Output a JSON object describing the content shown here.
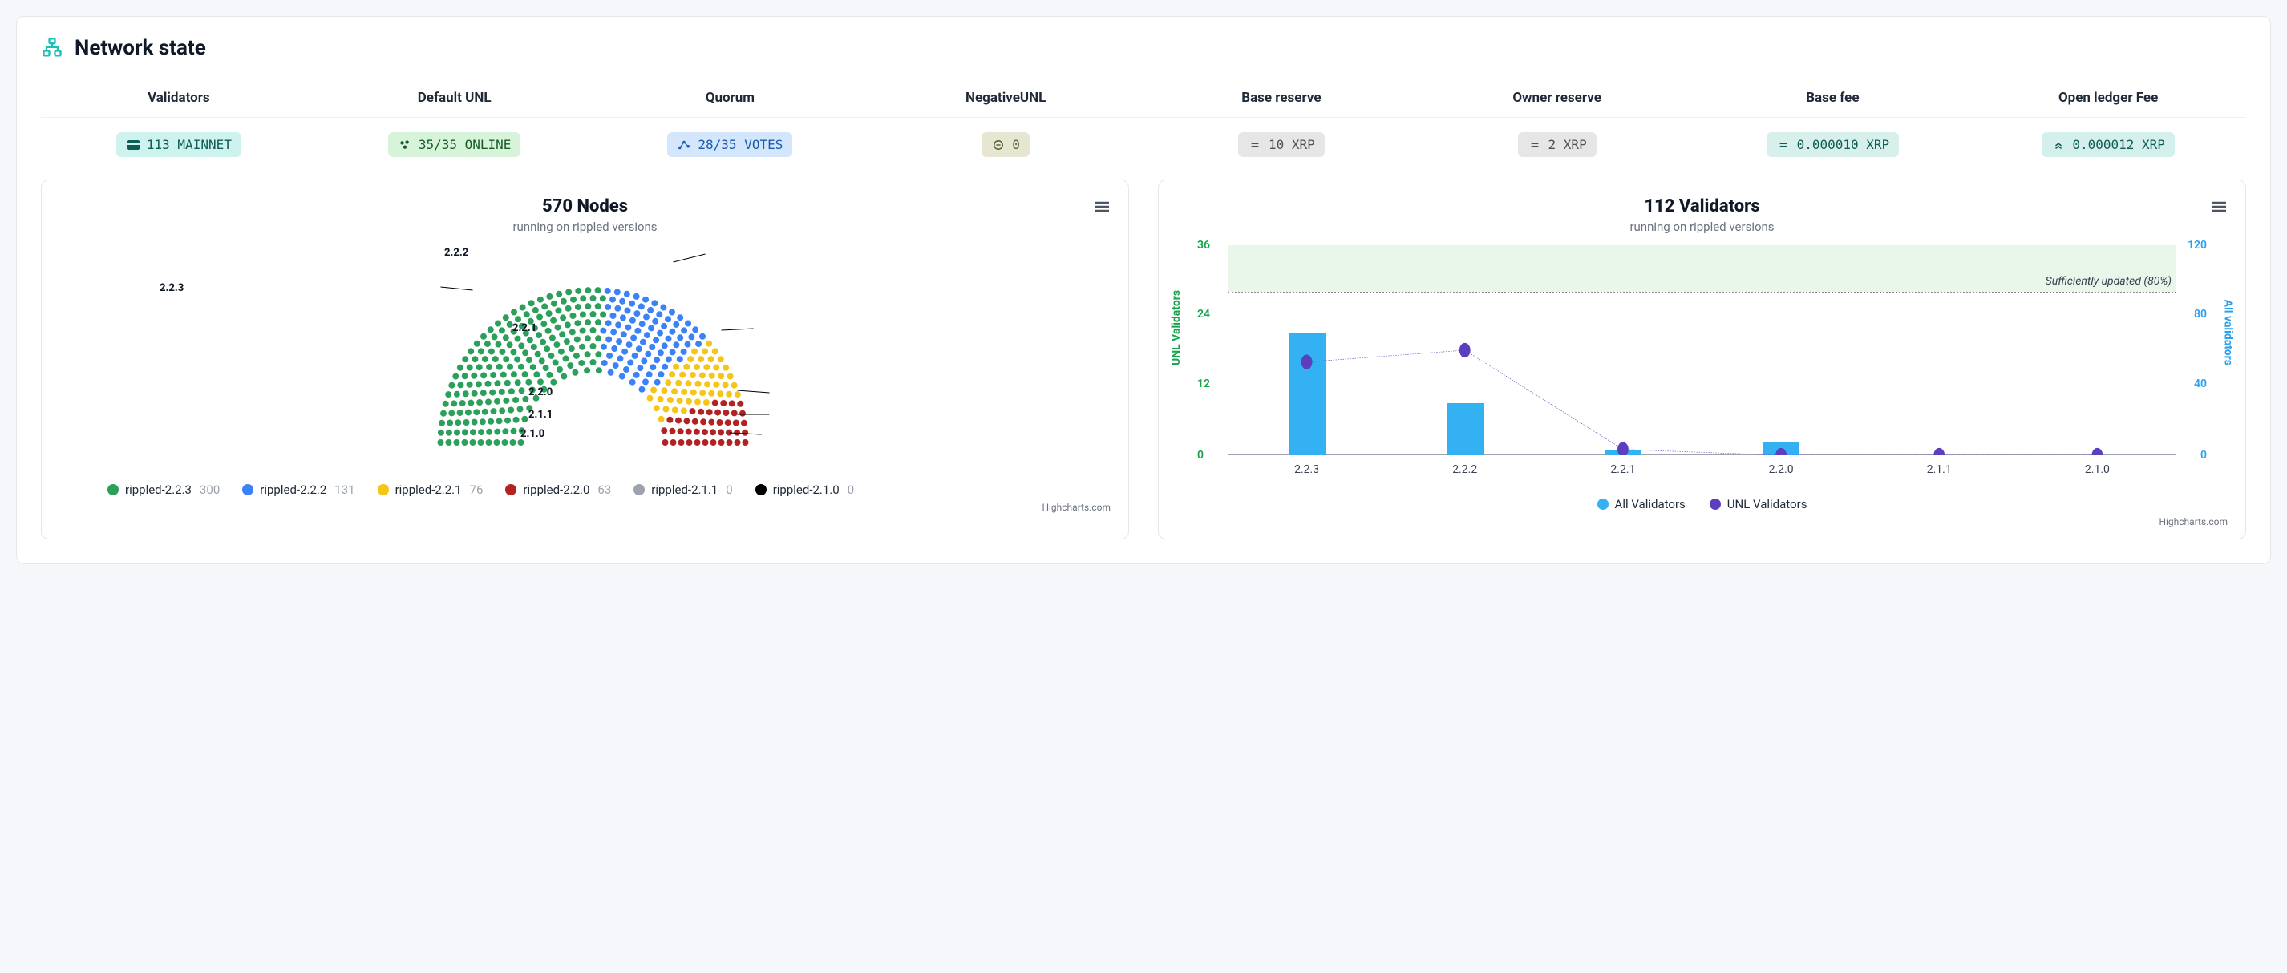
{
  "header": {
    "title": "Network state"
  },
  "stats": {
    "cols": [
      {
        "label": "Validators",
        "badge": "113 MAINNET",
        "class": "b-teal"
      },
      {
        "label": "Default UNL",
        "badge": "35/35 ONLINE",
        "class": "b-green"
      },
      {
        "label": "Quorum",
        "badge": "28/35 VOTES",
        "class": "b-blue"
      },
      {
        "label": "NegativeUNL",
        "badge": "0",
        "class": "b-olive"
      },
      {
        "label": "Base reserve",
        "badge": "10 XRP",
        "class": "b-gray"
      },
      {
        "label": "Owner reserve",
        "badge": "2 XRP",
        "class": "b-gray"
      },
      {
        "label": "Base fee",
        "badge": "0.000010 XRP",
        "class": "b-mint"
      },
      {
        "label": "Open ledger Fee",
        "badge": "0.000012 XRP",
        "class": "b-teal2"
      }
    ]
  },
  "nodes_chart": {
    "title": "570 Nodes",
    "subtitle": "running on rippled versions",
    "credits": "Highcharts.com",
    "labels": [
      "2.2.3",
      "2.2.2",
      "2.2.1",
      "2.2.0",
      "2.1.1",
      "2.1.0"
    ],
    "legend": [
      {
        "name": "rippled-2.2.3",
        "count": "300",
        "color": "#2aa05a"
      },
      {
        "name": "rippled-2.2.2",
        "count": "131",
        "color": "#3b82f6"
      },
      {
        "name": "rippled-2.2.1",
        "count": "76",
        "color": "#f5c518"
      },
      {
        "name": "rippled-2.2.0",
        "count": "63",
        "color": "#b22222"
      },
      {
        "name": "rippled-2.1.1",
        "count": "0",
        "color": "#9ca3af"
      },
      {
        "name": "rippled-2.1.0",
        "count": "0",
        "color": "#000000"
      }
    ]
  },
  "validators_chart": {
    "title": "112 Validators",
    "subtitle": "running on rippled versions",
    "credits": "Highcharts.com",
    "y_left_label": "UNL Validators",
    "y_right_label": "All validators",
    "band_text": "Sufficiently updated (80%)",
    "y_left_ticks": [
      "36",
      "24",
      "12",
      "0"
    ],
    "y_right_ticks": [
      "120",
      "80",
      "40",
      "0"
    ],
    "categories": [
      "2.2.3",
      "2.2.2",
      "2.2.1",
      "2.2.0",
      "2.1.1",
      "2.1.0"
    ],
    "legend": {
      "bars": "All Validators",
      "line": "UNL Validators"
    }
  },
  "chart_data": [
    {
      "type": "pie",
      "title": "570 Nodes",
      "subtitle": "running on rippled versions",
      "series": [
        {
          "name": "rippled-2.2.3",
          "value": 300
        },
        {
          "name": "rippled-2.2.2",
          "value": 131
        },
        {
          "name": "rippled-2.2.1",
          "value": 76
        },
        {
          "name": "rippled-2.2.0",
          "value": 63
        },
        {
          "name": "rippled-2.1.1",
          "value": 0
        },
        {
          "name": "rippled-2.1.0",
          "value": 0
        }
      ]
    },
    {
      "type": "bar",
      "title": "112 Validators",
      "subtitle": "running on rippled versions",
      "categories": [
        "2.2.3",
        "2.2.2",
        "2.2.1",
        "2.2.0",
        "2.1.1",
        "2.1.0"
      ],
      "series": [
        {
          "name": "All Validators",
          "axis": "right",
          "type": "bar",
          "values": [
            70,
            30,
            3,
            8,
            0,
            0
          ]
        },
        {
          "name": "UNL Validators",
          "axis": "left",
          "type": "line",
          "values": [
            16,
            18,
            1,
            0,
            0,
            0
          ]
        }
      ],
      "y_left": {
        "label": "UNL Validators",
        "range": [
          0,
          36
        ],
        "ticks": [
          0,
          12,
          24,
          36
        ]
      },
      "y_right": {
        "label": "All validators",
        "range": [
          0,
          120
        ],
        "ticks": [
          0,
          40,
          80,
          120
        ]
      },
      "band": {
        "label": "Sufficiently updated (80%)",
        "threshold_left": 28
      }
    }
  ]
}
